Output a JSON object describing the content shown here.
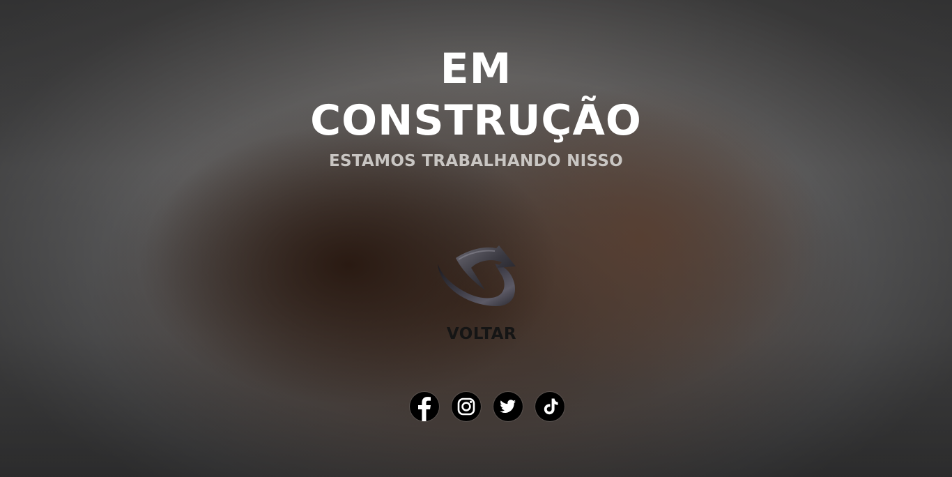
{
  "page": {
    "title_line1": "EM",
    "title_line2": "CONSTRUÇÃO",
    "subtitle": "ESTAMOS TRABALHANDO NISSO"
  },
  "back_button": {
    "label": "VOLTAR",
    "icon": "curved-back-arrow-icon"
  },
  "social_links": [
    {
      "name": "facebook",
      "icon": "facebook-icon"
    },
    {
      "name": "instagram",
      "icon": "instagram-icon"
    },
    {
      "name": "twitter",
      "icon": "twitter-icon"
    },
    {
      "name": "tiktok",
      "icon": "tiktok-icon"
    }
  ],
  "colors": {
    "title": "#ffffff",
    "subtitle": "#c9c6c3",
    "back_label": "#151515",
    "social_bg": "#000000"
  }
}
